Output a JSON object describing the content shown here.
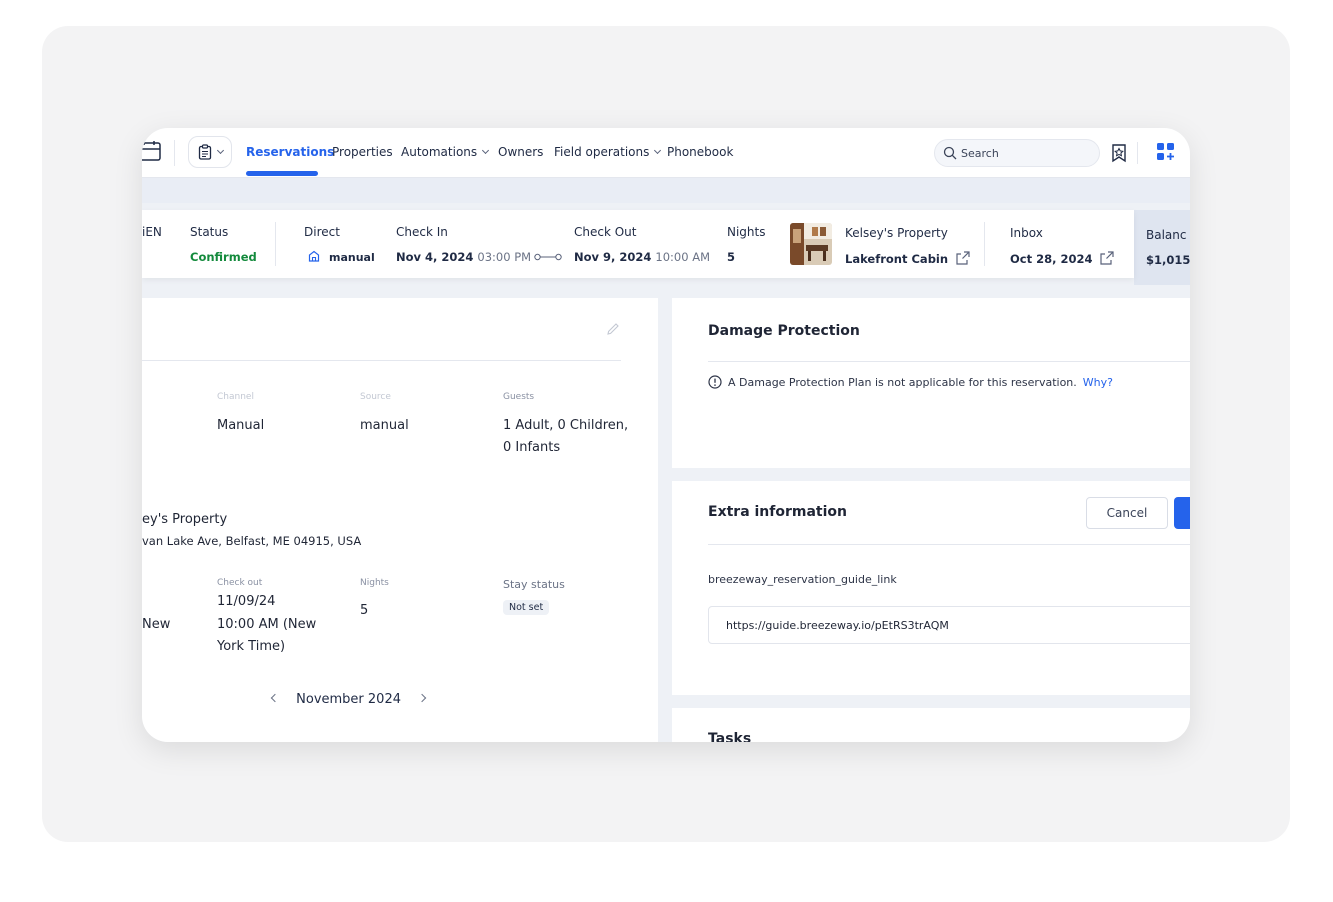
{
  "nav": {
    "items": [
      {
        "label": "Reservations",
        "active": true
      },
      {
        "label": "Properties"
      },
      {
        "label": "Automations",
        "dropdown": true
      },
      {
        "label": "Owners"
      },
      {
        "label": "Field operations",
        "dropdown": true
      },
      {
        "label": "Phonebook"
      }
    ],
    "search_placeholder": "Search"
  },
  "reservation_bar": {
    "partial_label": "iEN",
    "status_label": "Status",
    "status_value": "Confirmed",
    "direct_label": "Direct",
    "direct_value": "manual",
    "checkin_label": "Check In",
    "checkin_date": "Nov 4, 2024",
    "checkin_time": "03:00 PM",
    "checkout_label": "Check Out",
    "checkout_date": "Nov 9, 2024",
    "checkout_time": "10:00 AM",
    "nights_label": "Nights",
    "nights_value": "5",
    "property_label": "Kelsey's Property",
    "property_value": "Lakefront Cabin",
    "inbox_label": "Inbox",
    "inbox_value": "Oct 28, 2024",
    "balance_label": "Balanc",
    "balance_value": "$1,015"
  },
  "details": {
    "channel_label": "Channel",
    "channel_value": "Manual",
    "source_label": "Source",
    "source_value": "manual",
    "guests_label": "Guests",
    "guests_line1": "1 Adult, 0 Children,",
    "guests_line2": "0 Infants",
    "property_name": "ey's Property",
    "property_address": "van Lake Ave, Belfast, ME 04915, USA",
    "checkin_partial": "New",
    "checkout_label": "Check out",
    "checkout_date": "11/09/24",
    "checkout_time_line1": "10:00 AM (New",
    "checkout_time_line2": "York Time)",
    "nights_label": "Nights",
    "nights_value": "5",
    "stay_status_label": "Stay status",
    "stay_status_value": "Not set",
    "calendar_month": "November 2024"
  },
  "damage_protection": {
    "title": "Damage Protection",
    "message": "A Damage Protection Plan is not applicable for this reservation.",
    "link": "Why?"
  },
  "extra_info": {
    "title": "Extra information",
    "cancel_label": "Cancel",
    "field_label": "breezeway_reservation_guide_link",
    "field_value": "https://guide.breezeway.io/pEtRS3trAQM"
  },
  "tasks": {
    "title": "Tasks"
  },
  "colors": {
    "accent": "#2563eb",
    "confirmed": "#138a3c"
  }
}
